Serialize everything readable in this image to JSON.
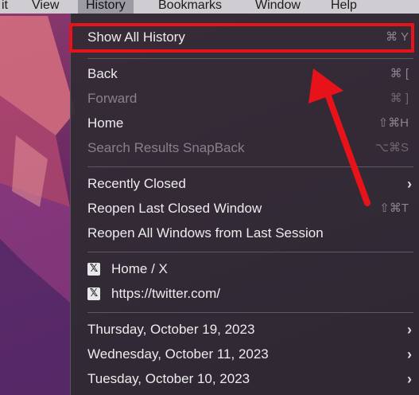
{
  "menubar": {
    "items": [
      {
        "label": "it"
      },
      {
        "label": "View"
      },
      {
        "label": "History"
      },
      {
        "label": "Bookmarks"
      },
      {
        "label": "Window"
      },
      {
        "label": "Help"
      }
    ],
    "active_item": "History"
  },
  "history_menu": {
    "show_all": {
      "label": "Show All History",
      "shortcut": "⌘ Y"
    },
    "back": {
      "label": "Back",
      "shortcut": "⌘ ["
    },
    "forward": {
      "label": "Forward",
      "shortcut": "⌘ ]"
    },
    "home": {
      "label": "Home",
      "shortcut": "⇧⌘H"
    },
    "snapback": {
      "label": "Search Results SnapBack",
      "shortcut": "⌥⌘S"
    },
    "recently_closed": {
      "label": "Recently Closed",
      "chevron": "›"
    },
    "reopen_last": {
      "label": "Reopen Last Closed Window",
      "shortcut": "⇧⌘T"
    },
    "reopen_all": {
      "label": "Reopen All Windows from Last Session"
    },
    "pages": [
      {
        "icon": "𝕏",
        "label": "Home / X"
      },
      {
        "icon": "𝕏",
        "label": "https://twitter.com/"
      }
    ],
    "dates": [
      {
        "label": "Thursday, October 19, 2023",
        "chevron": "›"
      },
      {
        "label": "Wednesday, October 11, 2023",
        "chevron": "›"
      },
      {
        "label": "Tuesday, October 10, 2023",
        "chevron": "›"
      }
    ]
  },
  "annotation": {
    "highlight_color": "#e8121b",
    "arrow_color": "#e8121b"
  }
}
